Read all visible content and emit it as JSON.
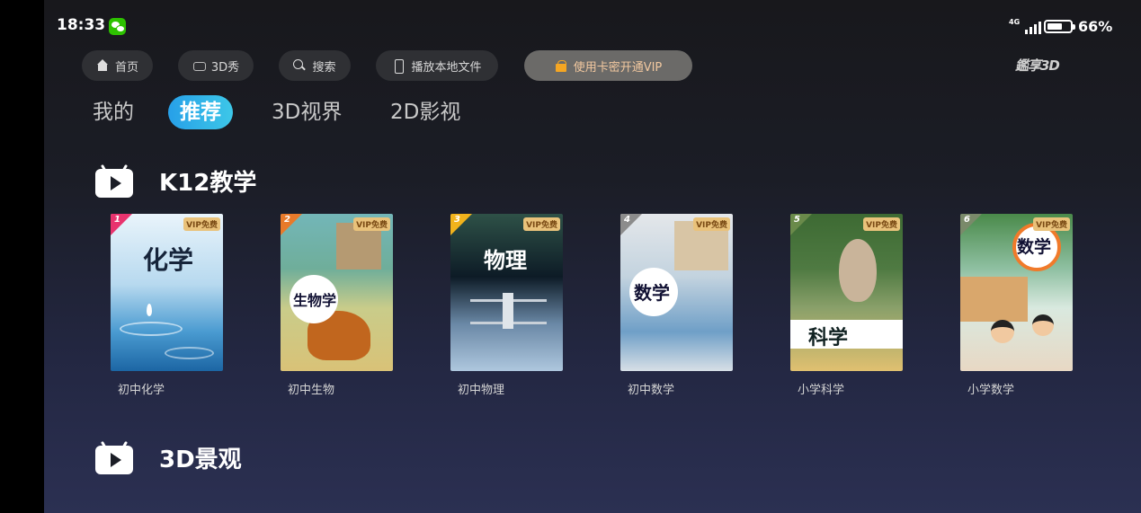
{
  "status_bar": {
    "time": "18:33",
    "network": "4G",
    "battery_pct": "66%",
    "battery_level": 0.66
  },
  "nav_buttons": {
    "home": "首页",
    "show3d": "3D秀",
    "search": "搜索",
    "local_play": "播放本地文件",
    "vip": "使用卡密开通VIP"
  },
  "logo_text": "鑑享3D",
  "tabs": [
    "我的",
    "推荐",
    "3D视界",
    "2D影视"
  ],
  "active_tab": "推荐",
  "sections": [
    {
      "title": "K12教学",
      "items": [
        {
          "num": "1",
          "label": "初中化学",
          "cover_title": "化学",
          "vip": "VIP免费",
          "accent": "#e8336e"
        },
        {
          "num": "2",
          "label": "初中生物",
          "cover_title": "生物学",
          "vip": "VIP免费",
          "accent": "#e87a2a"
        },
        {
          "num": "3",
          "label": "初中物理",
          "cover_title": "物理",
          "vip": "VIP免费",
          "accent": "#f1b31c"
        },
        {
          "num": "4",
          "label": "初中数学",
          "cover_title": "数学",
          "vip": "VIP免费",
          "accent": "#8c8c8c"
        },
        {
          "num": "5",
          "label": "小学科学",
          "cover_title": "科学",
          "vip": "VIP免费",
          "accent": "#6a8a4a"
        },
        {
          "num": "6",
          "label": "小学数学",
          "cover_title": "数学",
          "vip": "VIP免费",
          "accent": "#7a8a6a"
        }
      ]
    },
    {
      "title": "3D景观"
    }
  ],
  "colors": {
    "accent_tab": "#27a0e8",
    "vip_text": "#f3c9a0"
  }
}
